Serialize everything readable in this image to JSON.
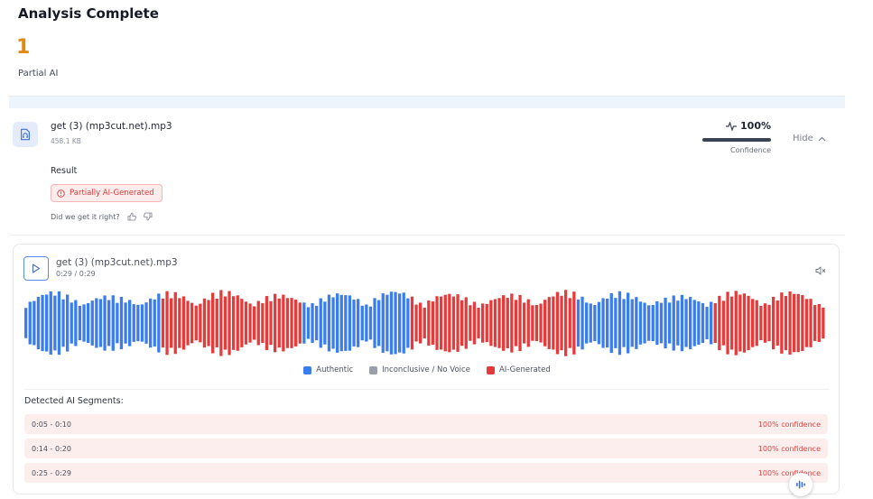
{
  "header": {
    "title": "Analysis Complete",
    "count": "1",
    "count_label": "Partial AI"
  },
  "file": {
    "name": "get (3) (mp3cut.net).mp3",
    "size": "458.1 KB",
    "icon": "audio-file-icon",
    "confidence_value": "100%",
    "confidence_fraction": 1.0,
    "confidence_label": "Confidence",
    "hide_label": "Hide",
    "result_label": "Result",
    "result_badge": "Partially AI-Generated",
    "feedback_prompt": "Did we get it right?"
  },
  "player": {
    "file_name": "get (3) (mp3cut.net).mp3",
    "time": "0:29 / 0:29",
    "duration_seconds": 29
  },
  "legend": {
    "authentic": "Authentic",
    "inconclusive": "Inconclusive / No Voice",
    "ai_generated": "AI-Generated"
  },
  "colors": {
    "authentic": "#3b7ded",
    "inconclusive": "#9aa0aa",
    "ai_generated": "#e63b3b",
    "accent_orange": "#e08a12"
  },
  "segments": {
    "title": "Detected AI Segments:",
    "items": [
      {
        "range": "0:05 - 0:10",
        "confidence": "100% confidence"
      },
      {
        "range": "0:14 - 0:20",
        "confidence": "100% confidence"
      },
      {
        "range": "0:25 - 0:29",
        "confidence": "100% confidence"
      }
    ]
  },
  "waveform_classes": [
    {
      "start": 0,
      "end": 5,
      "class": "authentic"
    },
    {
      "start": 5,
      "end": 10,
      "class": "ai_generated"
    },
    {
      "start": 10,
      "end": 14,
      "class": "authentic"
    },
    {
      "start": 14,
      "end": 20,
      "class": "ai_generated"
    },
    {
      "start": 20,
      "end": 25,
      "class": "authentic"
    },
    {
      "start": 25,
      "end": 29,
      "class": "ai_generated"
    }
  ]
}
